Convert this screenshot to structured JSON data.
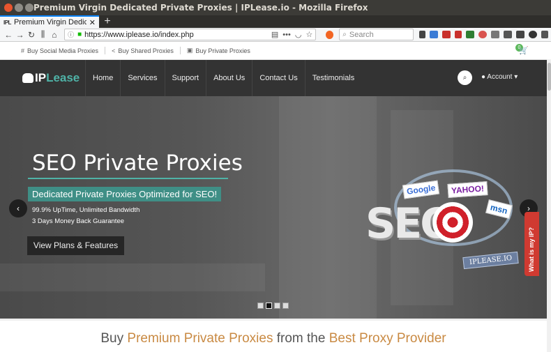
{
  "window": {
    "title": "Premium Virgin Dedicated Private Proxies | IPLease.io - Mozilla Firefox"
  },
  "tab": {
    "favicon": "IPL",
    "title": "Premium Virgin Dedicat",
    "close": "✕",
    "new": "+"
  },
  "nav": {
    "url": "https://www.iplease.io/index.php",
    "search_placeholder": "Search"
  },
  "toplinks": [
    {
      "icon": "hashtag-icon",
      "glyph": "#",
      "label": "Buy Social Media Proxies"
    },
    {
      "icon": "share-icon",
      "glyph": "<",
      "label": "Buy Shared Proxies"
    },
    {
      "icon": "lock-icon",
      "glyph": "🔒",
      "label": "Buy Private Proxies"
    }
  ],
  "cart": {
    "count": "0"
  },
  "header": {
    "logo_ip": "IP",
    "logo_lease": "Lease",
    "menu": [
      "Home",
      "Services",
      "Support",
      "About Us",
      "Contact Us",
      "Testimonials"
    ],
    "account": "Account"
  },
  "hero": {
    "title": "SEO Private Proxies",
    "tagline": "Dedicated Private Proxies Optimized for SEO!",
    "feature1": "99.9% UpTime, Unlimited Bandwidth",
    "feature2": "3 Days Money Back Guarantee",
    "button": "View Plans & Features",
    "prev": "‹",
    "next": "›",
    "whatip": "What is my IP?",
    "art": {
      "google": "Google",
      "yahoo": "YAHOO!",
      "msn": "msn",
      "seo": "SEO",
      "badge": "IPLEASE.IO"
    }
  },
  "bottom": {
    "pre": "Buy ",
    "accent1": "Premium Private Proxies",
    "mid": " from the ",
    "accent2": "Best Proxy Provider"
  },
  "colors": {
    "accent": "#4fb3a7",
    "headline_accent": "#c98a43",
    "what_ip": "#d03a31"
  }
}
